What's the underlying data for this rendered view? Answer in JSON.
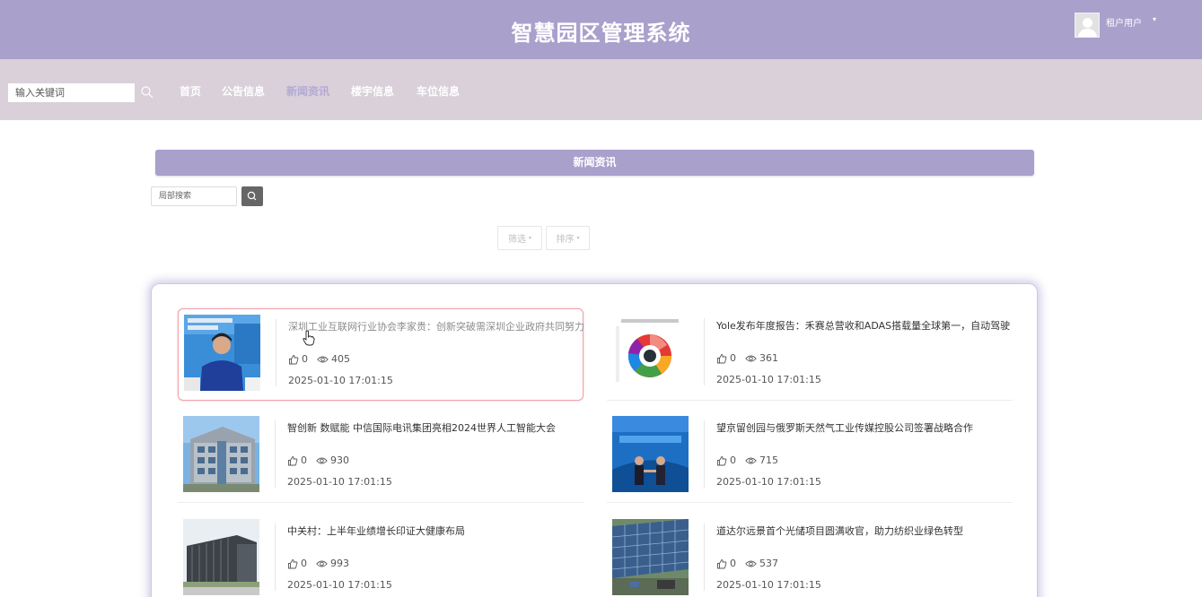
{
  "header": {
    "title": "智慧园区管理系统",
    "user_name": "租户用户",
    "caret": "▾"
  },
  "nav": {
    "search_placeholder": "输入关键词",
    "links": [
      "首页",
      "公告信息",
      "新闻资讯",
      "楼宇信息",
      "车位信息"
    ],
    "active": "新闻资讯"
  },
  "section": {
    "title": "新闻资讯",
    "local_search_placeholder": "局部搜索"
  },
  "filters": {
    "filter_label": "筛选",
    "sort_label": "排序",
    "caret": "▾"
  },
  "news": [
    {
      "title": "深圳工业互联网行业协会李家贵：创新突破需深圳企业政府共同努力",
      "likes": "0",
      "views": "405",
      "date": "2025-01-10 17:01:15",
      "thumb": "person-interview"
    },
    {
      "title": "Yole发布年度报告：禾赛总营收和ADAS搭载量全球第一，自动驾驶",
      "likes": "0",
      "views": "361",
      "date": "2025-01-10 17:01:15",
      "thumb": "donut-chart"
    },
    {
      "title": "智创新 数赋能 中信国际电讯集团亮相2024世界人工智能大会",
      "likes": "0",
      "views": "930",
      "date": "2025-01-10 17:01:15",
      "thumb": "office-building"
    },
    {
      "title": "望京留创园与俄罗斯天然气工业传媒控股公司签署战略合作",
      "likes": "0",
      "views": "715",
      "date": "2025-01-10 17:01:15",
      "thumb": "signing-ceremony"
    },
    {
      "title": "中关村：上半年业绩增长印证大健康布局",
      "likes": "0",
      "views": "993",
      "date": "2025-01-10 17:01:15",
      "thumb": "modern-building"
    },
    {
      "title": "道达尔远景首个光储项目圆满收官，助力纺织业绿色转型",
      "likes": "0",
      "views": "537",
      "date": "2025-01-10 17:01:15",
      "thumb": "solar-roof"
    }
  ],
  "colors": {
    "header_bg": "#a9a0cc",
    "nav_bg": "#d9d0d9",
    "active_link": "#b3a9d6",
    "selected_border": "#f0a1ab"
  }
}
